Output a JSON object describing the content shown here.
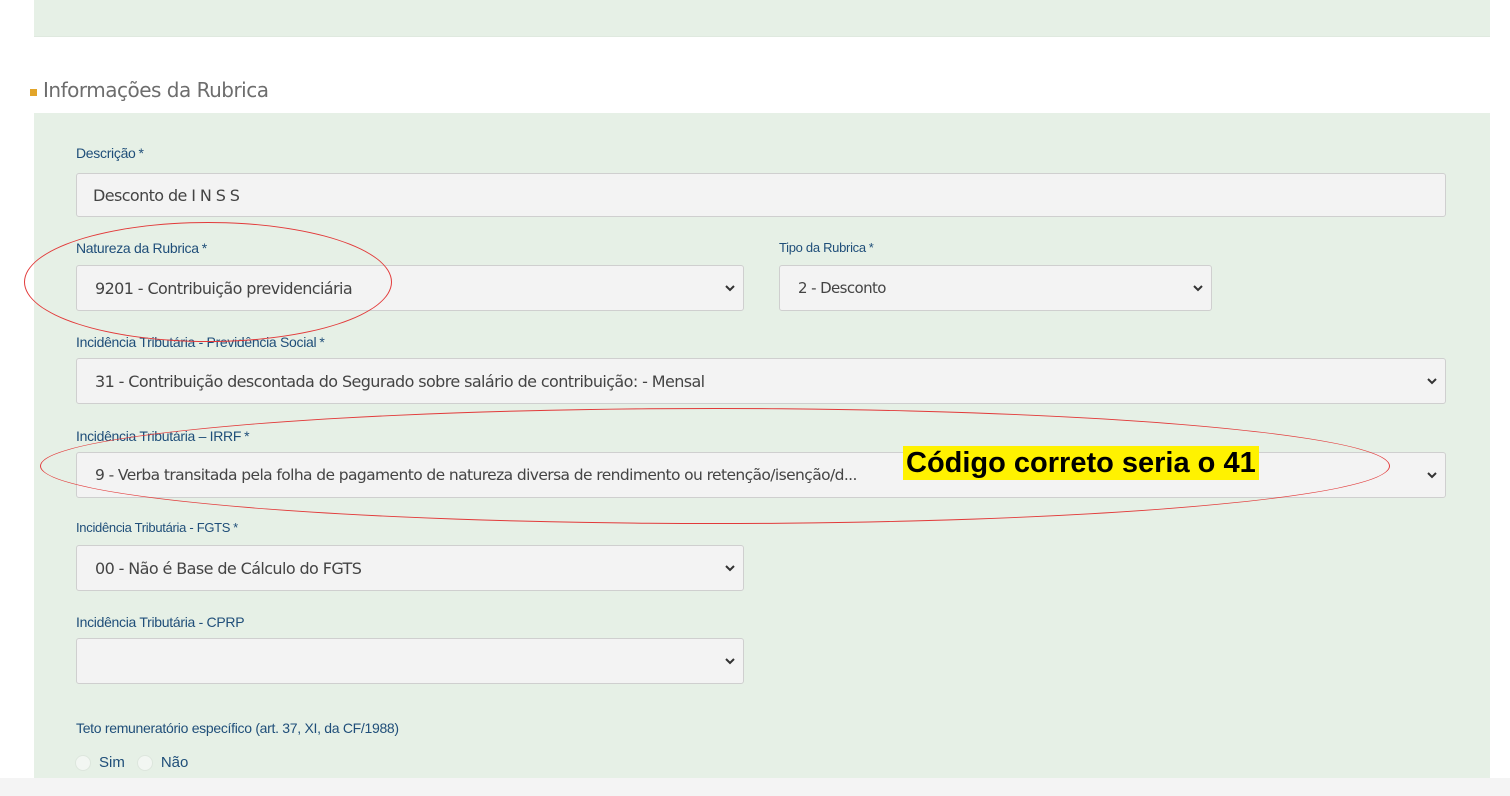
{
  "section": {
    "title": "Informações da Rubrica"
  },
  "fields": {
    "descricao": {
      "label": "Descrição",
      "required": "*",
      "value": "Desconto de I N S S"
    },
    "natureza": {
      "label": "Natureza da Rubrica",
      "required": "*",
      "value": "9201 - Contribuição previdenciária"
    },
    "tipo": {
      "label": "Tipo da Rubrica",
      "required": "*",
      "value": "2 - Desconto"
    },
    "prev_social": {
      "label": "Incidência Tributária - Previdência Social",
      "required": "*",
      "value": "31 - Contribuição descontada do Segurado sobre salário de contribuição: - Mensal"
    },
    "irrf": {
      "label": "Incidência Tributária – IRRF",
      "required": "*",
      "value": "9 - Verba transitada pela folha de pagamento de natureza diversa de rendimento ou retenção/isenção/d..."
    },
    "fgts": {
      "label": "Incidência Tributária - FGTS",
      "required": "*",
      "value": "00 - Não é Base de Cálculo do FGTS"
    },
    "cprp": {
      "label": "Incidência Tributária - CPRP",
      "value": ""
    },
    "teto": {
      "label": "Teto remuneratório específico (art. 37, XI, da CF/1988)",
      "options": [
        "Sim",
        "Não"
      ]
    }
  },
  "annotation": {
    "note": "Código correto seria o 41",
    "highlight_color": "#fff200",
    "ellipse_color": "#e23a3a"
  },
  "colors": {
    "panel_bg": "#e6f0e6",
    "label": "#1f4e79",
    "section_bullet": "#e2a52a"
  },
  "icons": {
    "select_arrow": "chevron-down-icon"
  }
}
